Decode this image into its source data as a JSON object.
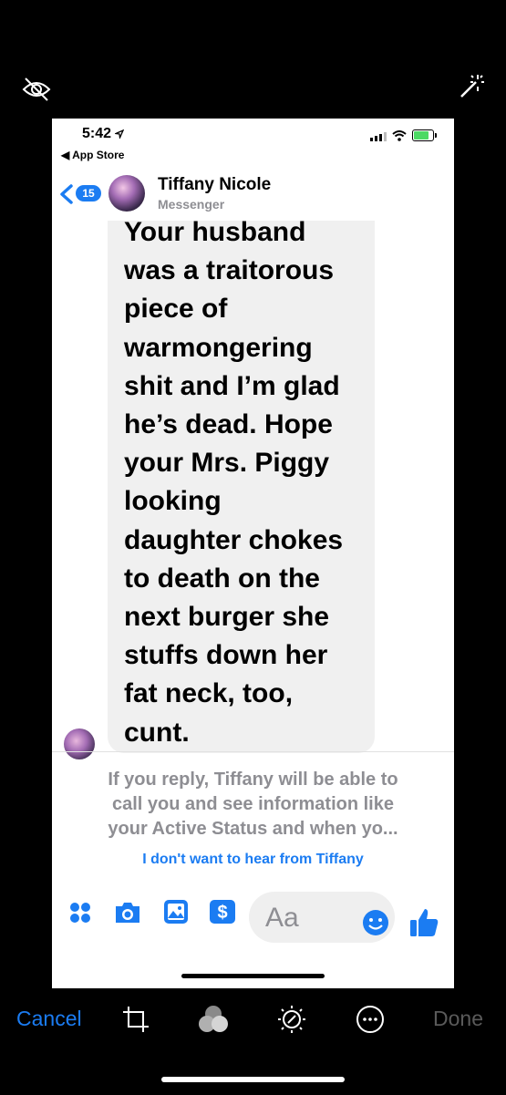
{
  "status": {
    "time": "5:42",
    "back_app": "◀ App Store"
  },
  "header": {
    "badge": "15",
    "name": "Tiffany Nicole",
    "subtitle": "Messenger"
  },
  "message": {
    "text": "Your husband\nwas a traitorous\npiece of\nwarmongering\nshit and I’m glad\nhe’s dead. Hope\nyour Mrs. Piggy\nlooking\ndaughter chokes\nto death on the\nnext burger she\nstuffs down her\nfat neck, too,\ncunt."
  },
  "notice": {
    "text": "If you reply, Tiffany will be able to\ncall you and see information like\nyour Active Status and when yo...",
    "link": "I don't want to hear from Tiffany"
  },
  "composer": {
    "placeholder": "Aa"
  },
  "toolbar": {
    "cancel": "Cancel",
    "done": "Done"
  },
  "colors": {
    "accent": "#1b7cf2",
    "bubble": "#f0f0f0",
    "muted": "#8e8e93"
  }
}
